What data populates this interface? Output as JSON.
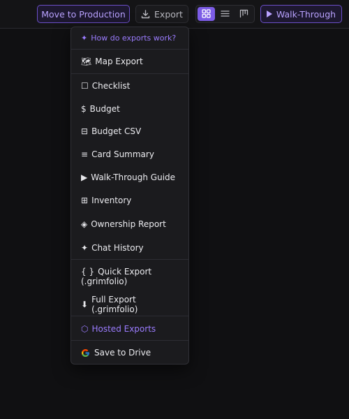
{
  "toolbar": {
    "move_to_production": "Move to Production",
    "export_label": "Export",
    "walk_through_label": "Walk-Through",
    "view_modes": [
      "grid",
      "list",
      "board"
    ],
    "active_view": "grid"
  },
  "export_menu": {
    "help": {
      "icon": "✦",
      "label": "How do exports work?"
    },
    "items": [
      {
        "icon": "🗺",
        "label": "Map Export"
      },
      {
        "icon": "☐",
        "label": "Checklist"
      },
      {
        "icon": "$",
        "label": "Budget"
      },
      {
        "icon": "⊟",
        "label": "Budget CSV"
      },
      {
        "icon": "≡",
        "label": "Card Summary"
      },
      {
        "icon": "▶",
        "label": "Walk-Through Guide"
      },
      {
        "icon": "⊞",
        "label": "Inventory"
      },
      {
        "icon": "◈",
        "label": "Ownership Report"
      },
      {
        "icon": "✦",
        "label": "Chat History"
      },
      {
        "icon": "{ }",
        "label": "Quick Export (.grimfolio)"
      },
      {
        "icon": "⬇",
        "label": "Full Export (.grimfolio)"
      },
      {
        "icon": "⬡",
        "label": "Hosted Exports"
      },
      {
        "icon": "google-icon",
        "label": "Save to Drive"
      }
    ]
  },
  "colors": {
    "accent": "#9b7cff",
    "accent_border": "#6b4fc9",
    "background": "#101012",
    "menu_bg": "#1b1b1e"
  }
}
